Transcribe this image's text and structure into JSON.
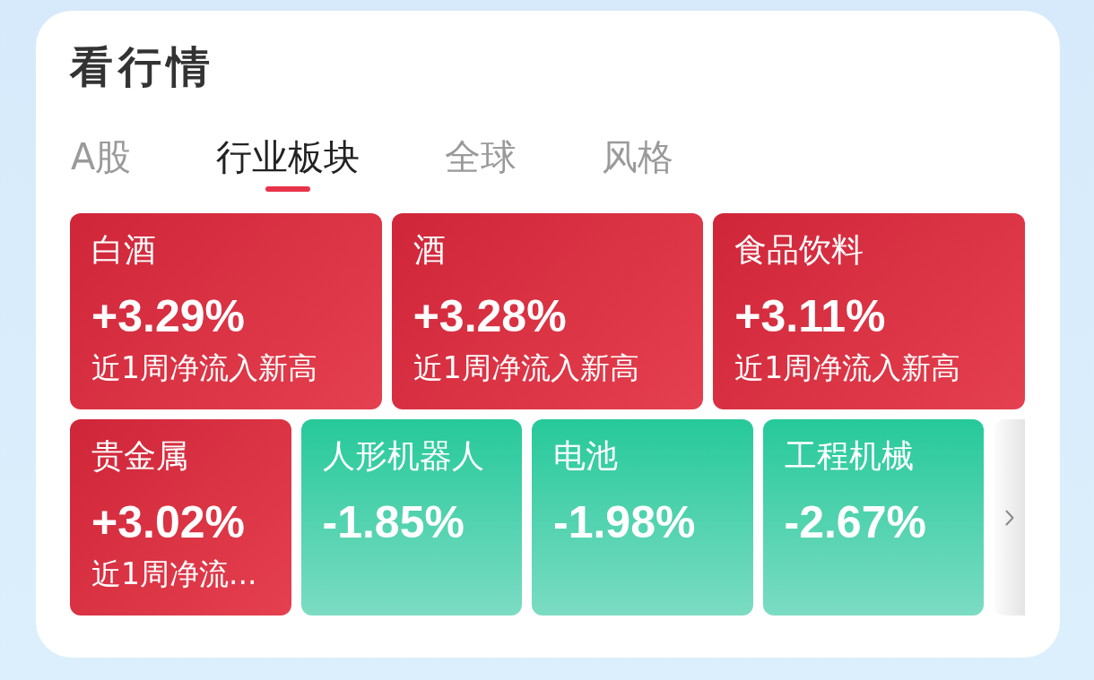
{
  "title": "看行情",
  "tabs": [
    {
      "label": "A股",
      "selected": false
    },
    {
      "label": "行业板块",
      "selected": true
    },
    {
      "label": "全球",
      "selected": false
    },
    {
      "label": "风格",
      "selected": false
    }
  ],
  "sector_rows": [
    {
      "has_more": false,
      "sectors": [
        {
          "name": "白酒",
          "change": "+3.29%",
          "note": "近1周净流入新高",
          "rising": true
        },
        {
          "name": "酒",
          "change": "+3.28%",
          "note": "近1周净流入新高",
          "rising": true
        },
        {
          "name": "食品饮料",
          "change": "+3.11%",
          "note": "近1周净流入新高",
          "rising": true
        }
      ]
    },
    {
      "has_more": true,
      "sectors": [
        {
          "name": "贵金属",
          "change": "+3.02%",
          "note": "近1周净流...",
          "rising": true
        },
        {
          "name": "人形机器人",
          "change": "-1.85%",
          "rising": false
        },
        {
          "name": "电池",
          "change": "-1.98%",
          "rising": false
        },
        {
          "name": "工程机械",
          "change": "-2.67%",
          "rising": false
        }
      ]
    }
  ]
}
